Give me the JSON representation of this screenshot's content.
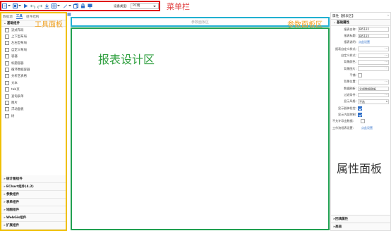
{
  "toolbar": {
    "device_label": "设备类型:",
    "device_value": "PC端",
    "icons": [
      "new-icon",
      "open-icon",
      "play-icon",
      "undo-icon",
      "redo-icon",
      "save-icon",
      "grid-icon",
      "brush-icon",
      "copy-icon",
      "lock-icon",
      "device-icon"
    ]
  },
  "callouts": {
    "menubar": "菜单栏",
    "left_panel": "工具面板",
    "param_panel": "参数面板区",
    "design": "报表设计区",
    "property_panel": "属性面板"
  },
  "left_panel": {
    "tabs": [
      "数据源",
      "工具",
      "组件结构"
    ],
    "active_tab": "工具",
    "top_group": "基础组件",
    "items": [
      {
        "label": "流式布局",
        "icon": "layout-flow-icon"
      },
      {
        "label": "上下型布局",
        "icon": "layout-vertical-icon"
      },
      {
        "label": "左右型布局",
        "icon": "layout-horizontal-icon"
      },
      {
        "label": "自定义布局",
        "icon": "layout-custom-icon"
      },
      {
        "label": "容器",
        "icon": "container-icon"
      },
      {
        "label": "标题容器",
        "icon": "title-container-icon"
      },
      {
        "label": "循环数据容器",
        "icon": "loop-container-icon"
      },
      {
        "label": "分析区表格",
        "icon": "table-icon"
      },
      {
        "label": "文本",
        "icon": "text-icon"
      },
      {
        "label": "tab页",
        "icon": "tab-icon"
      },
      {
        "label": "查询表单",
        "icon": "form-icon"
      },
      {
        "label": "图片",
        "icon": "image-icon"
      },
      {
        "label": "浮动面板",
        "icon": "float-panel-icon"
      },
      {
        "label": "树",
        "icon": "tree-icon"
      }
    ],
    "bottom_groups": [
      "统计图组件",
      "EChart组件(4.2)",
      "参数组件",
      "表单组件",
      "地图组件",
      "WebGis组件",
      "扩展组件"
    ]
  },
  "param_panel": {
    "label": "参数面板区"
  },
  "right_panel": {
    "title": "属性【报表区】",
    "group": "基础属性",
    "rows": [
      {
        "label": "报表名称:",
        "type": "input",
        "value": "BI5122"
      },
      {
        "label": "报表标题:",
        "type": "input",
        "value": "BI5122"
      },
      {
        "label": "报表说明:",
        "type": "link",
        "value": "点此设置"
      },
      {
        "label": "报表自定义样式:",
        "type": "dots",
        "value": ""
      },
      {
        "label": "自定义样式:",
        "type": "dots",
        "value": ""
      },
      {
        "label": "背景颜色:",
        "type": "dots",
        "value": ""
      },
      {
        "label": "背景图片:",
        "type": "dots",
        "value": ""
      },
      {
        "label": "平铺:",
        "type": "check",
        "checked": false
      },
      {
        "label": "背景位置:",
        "type": "dots",
        "value": ""
      },
      {
        "label": "数据刷新:",
        "type": "input",
        "value": "全部数据刷新"
      },
      {
        "label": "过滤条件:",
        "type": "dots",
        "value": ""
      },
      {
        "label": "显示风格:",
        "type": "select",
        "value": "不选"
      },
      {
        "label": "显示器体检控:",
        "type": "check",
        "checked": true
      },
      {
        "label": "显示内部控制:",
        "type": "check",
        "checked": true
      },
      {
        "label": "不允许导出数据:",
        "type": "check",
        "checked": false,
        "wide": true
      },
      {
        "label": "工作流程表设置:",
        "type": "link",
        "value": "点此设置",
        "wide": true
      }
    ],
    "bottom_groups": [
      "回填属性",
      "高级"
    ]
  }
}
